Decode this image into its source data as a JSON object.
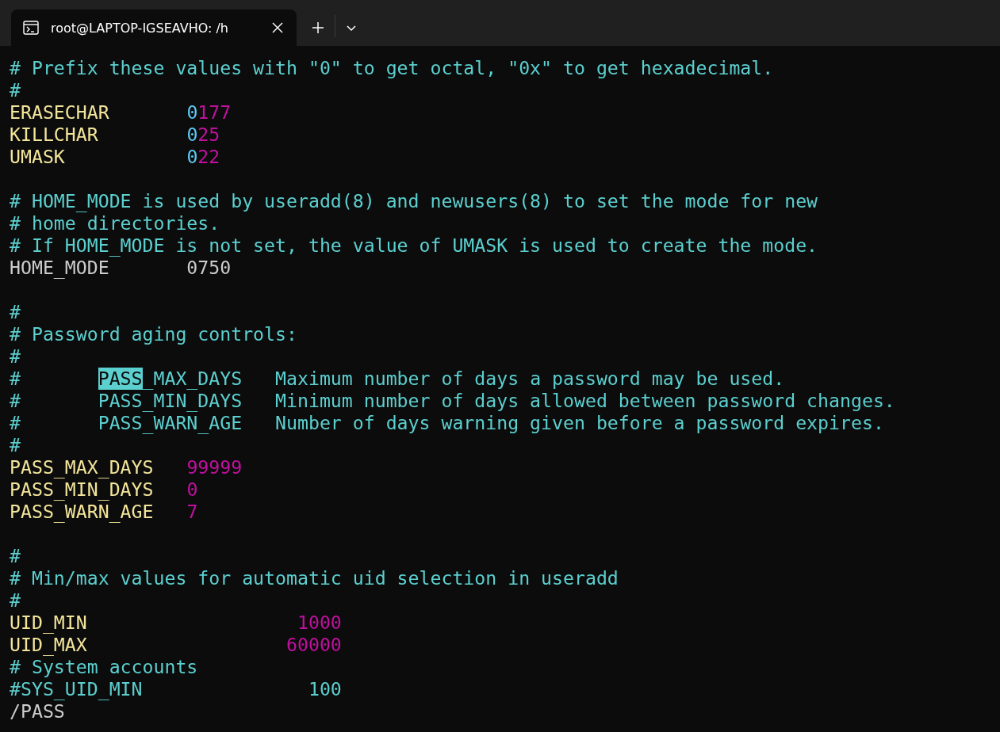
{
  "tab": {
    "title": "root@LAPTOP-IGSEAVHO: /h",
    "selected": true
  },
  "terminal": {
    "lines": [
      [
        {
          "kind": "comment",
          "text": "# Prefix these values with \"0\" to get octal, \"0x\" to get hexadecimal."
        }
      ],
      [
        {
          "kind": "comment",
          "text": "#"
        }
      ],
      [
        {
          "kind": "keyword",
          "text": "ERASECHAR       "
        },
        {
          "kind": "prefix",
          "text": "0"
        },
        {
          "kind": "number",
          "text": "177"
        }
      ],
      [
        {
          "kind": "keyword",
          "text": "KILLCHAR        "
        },
        {
          "kind": "prefix",
          "text": "0"
        },
        {
          "kind": "number",
          "text": "25"
        }
      ],
      [
        {
          "kind": "keyword",
          "text": "UMASK           "
        },
        {
          "kind": "prefix",
          "text": "0"
        },
        {
          "kind": "number",
          "text": "22"
        }
      ],
      [
        {
          "kind": "blank"
        }
      ],
      [
        {
          "kind": "comment",
          "text": "# HOME_MODE is used by useradd(8) and newusers(8) to set the mode for new"
        }
      ],
      [
        {
          "kind": "comment",
          "text": "# home directories."
        }
      ],
      [
        {
          "kind": "comment",
          "text": "# If HOME_MODE is not set, the value of UMASK is used to create the mode."
        }
      ],
      [
        {
          "kind": "plain",
          "text": "HOME_MODE       0750"
        }
      ],
      [
        {
          "kind": "blank"
        }
      ],
      [
        {
          "kind": "comment",
          "text": "#"
        }
      ],
      [
        {
          "kind": "comment",
          "text": "# Password aging controls:"
        }
      ],
      [
        {
          "kind": "comment",
          "text": "#"
        }
      ],
      [
        {
          "kind": "comment",
          "text": "#       "
        },
        {
          "kind": "match",
          "text": "PASS"
        },
        {
          "kind": "comment",
          "text": "_MAX_DAYS   Maximum number of days a password may be used."
        }
      ],
      [
        {
          "kind": "comment",
          "text": "#       PASS_MIN_DAYS   Minimum number of days allowed between password changes."
        }
      ],
      [
        {
          "kind": "comment",
          "text": "#       PASS_WARN_AGE   Number of days warning given before a password expires."
        }
      ],
      [
        {
          "kind": "comment",
          "text": "#"
        }
      ],
      [
        {
          "kind": "keyword",
          "text": "PASS_MAX_DAYS   "
        },
        {
          "kind": "number",
          "text": "99999"
        }
      ],
      [
        {
          "kind": "keyword",
          "text": "PASS_MIN_DAYS   "
        },
        {
          "kind": "number",
          "text": "0"
        }
      ],
      [
        {
          "kind": "keyword",
          "text": "PASS_WARN_AGE   "
        },
        {
          "kind": "number",
          "text": "7"
        }
      ],
      [
        {
          "kind": "blank"
        }
      ],
      [
        {
          "kind": "comment",
          "text": "#"
        }
      ],
      [
        {
          "kind": "comment",
          "text": "# Min/max values for automatic uid selection in useradd"
        }
      ],
      [
        {
          "kind": "comment",
          "text": "#"
        }
      ],
      [
        {
          "kind": "keyword",
          "text": "UID_MIN                   "
        },
        {
          "kind": "number",
          "text": "1000"
        }
      ],
      [
        {
          "kind": "keyword",
          "text": "UID_MAX                  "
        },
        {
          "kind": "number",
          "text": "60000"
        }
      ],
      [
        {
          "kind": "comment",
          "text": "# System accounts"
        }
      ],
      [
        {
          "kind": "comment",
          "text": "#SYS_UID_MIN               100"
        }
      ],
      [
        {
          "kind": "plain",
          "text": "/PASS"
        }
      ]
    ]
  }
}
